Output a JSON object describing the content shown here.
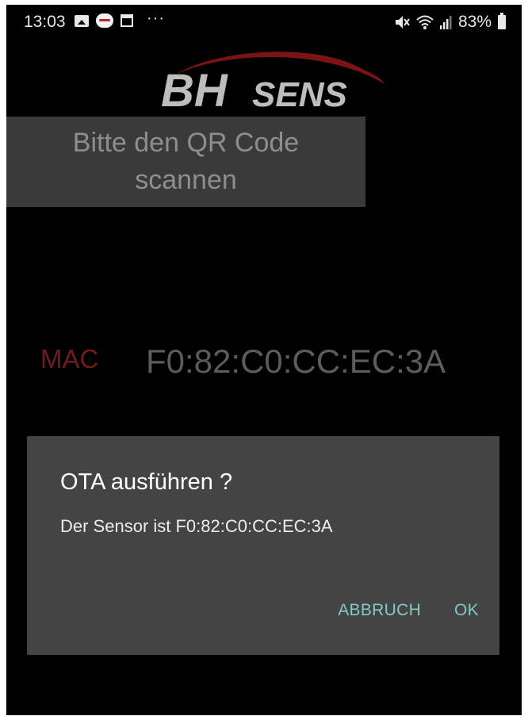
{
  "status_bar": {
    "time": "13:03",
    "battery": "83%",
    "more": "···",
    "icons": [
      "gallery-icon",
      "app-notification-icon",
      "calendar-icon",
      "mute-icon",
      "wifi-icon",
      "signal-icon",
      "battery-icon"
    ]
  },
  "logo": {
    "text_primary": "BH",
    "text_secondary": "SENS",
    "colors": {
      "primary": "#bdbdbd",
      "swoosh": "#7a1414"
    }
  },
  "qr_button": {
    "label": "Bitte den QR Code scannen"
  },
  "mac": {
    "label": "MAC",
    "value": "F0:82:C0:CC:EC:3A"
  },
  "dialog": {
    "title": "OTA ausführen ?",
    "message": "Der Sensor ist F0:82:C0:CC:EC:3A",
    "cancel_label": "ABBRUCH",
    "ok_label": "OK",
    "accent_color": "#80cbc4"
  }
}
